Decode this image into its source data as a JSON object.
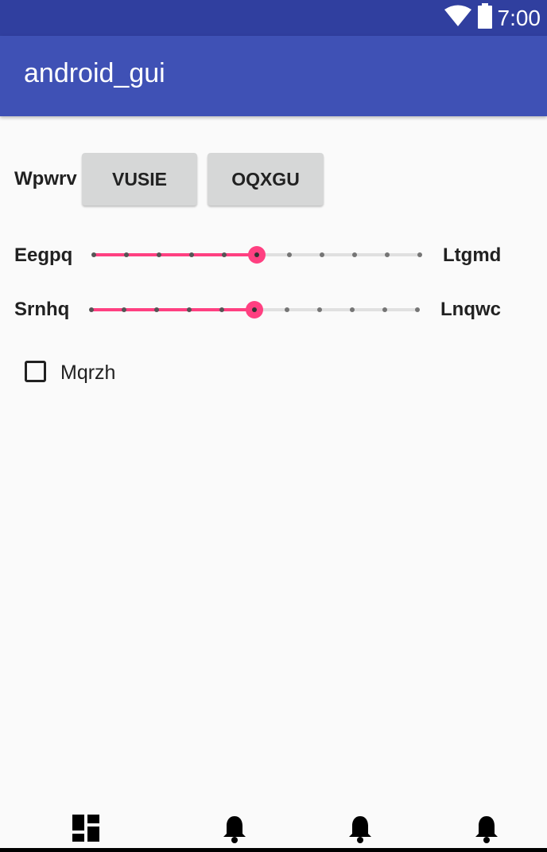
{
  "status_bar": {
    "time": "7:00",
    "icons": [
      "wifi-icon",
      "battery-icon"
    ]
  },
  "app_bar": {
    "title": "android_gui"
  },
  "button_row": {
    "label": "Wpwrv",
    "buttons": [
      "VUSIE",
      "OQXGU"
    ]
  },
  "sliders": [
    {
      "left_label": "Eegpq",
      "right_label": "Ltgmd",
      "steps": 10,
      "value": 5
    },
    {
      "left_label": "Srnhq",
      "right_label": "Lnqwc",
      "steps": 10,
      "value": 5
    }
  ],
  "checkbox": {
    "label": "Mqrzh",
    "checked": false
  },
  "bottom_nav": {
    "icons": [
      "dashboard-icon",
      "notifications-icon",
      "notifications-icon",
      "notifications-icon"
    ]
  },
  "colors": {
    "status_bar": "#303f9f",
    "app_bar": "#3f51b5",
    "accent": "#ff4081",
    "button": "#d6d7d7"
  }
}
